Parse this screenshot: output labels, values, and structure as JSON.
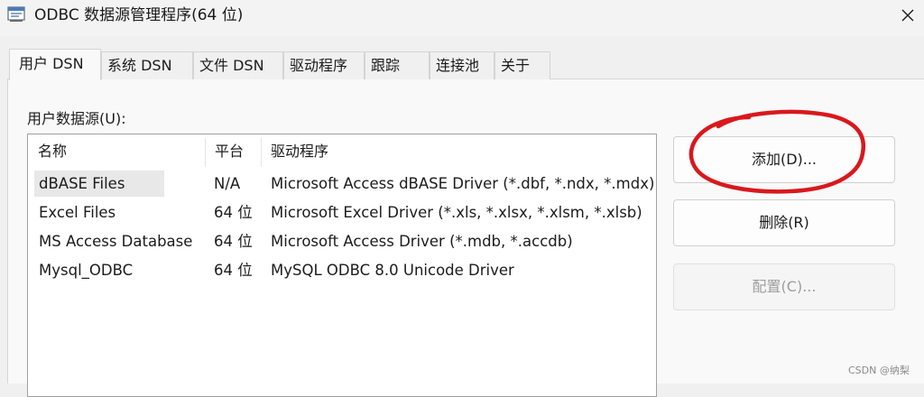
{
  "window": {
    "title": "ODBC 数据源管理程序(64 位)",
    "app_icon": "odbc-admin-icon",
    "close_icon": "close-icon"
  },
  "tabs": [
    {
      "label": "用户 DSN",
      "active": true
    },
    {
      "label": "系统 DSN",
      "active": false
    },
    {
      "label": "文件 DSN",
      "active": false
    },
    {
      "label": "驱动程序",
      "active": false
    },
    {
      "label": "跟踪",
      "active": false
    },
    {
      "label": "连接池",
      "active": false
    },
    {
      "label": "关于",
      "active": false
    }
  ],
  "panel": {
    "section_label": "用户数据源(U):",
    "columns": [
      "名称",
      "平台",
      "驱动程序"
    ],
    "rows": [
      {
        "name": "dBASE Files",
        "platform": "N/A",
        "driver": "Microsoft Access dBASE Driver (*.dbf, *.ndx, *.mdx)",
        "selected": true
      },
      {
        "name": "Excel Files",
        "platform": "64 位",
        "driver": "Microsoft Excel Driver (*.xls, *.xlsx, *.xlsm, *.xlsb)",
        "selected": false
      },
      {
        "name": "MS Access Database",
        "platform": "64 位",
        "driver": "Microsoft Access Driver (*.mdb, *.accdb)",
        "selected": false
      },
      {
        "name": "Mysql_ODBC",
        "platform": "64 位",
        "driver": "MySQL ODBC 8.0 Unicode Driver",
        "selected": false
      }
    ]
  },
  "buttons": {
    "add": "添加(D)...",
    "remove": "删除(R)",
    "configure": "配置(C)...",
    "configure_enabled": false
  },
  "annotation_color": "#d9181d",
  "watermark": "CSDN @纳梨"
}
